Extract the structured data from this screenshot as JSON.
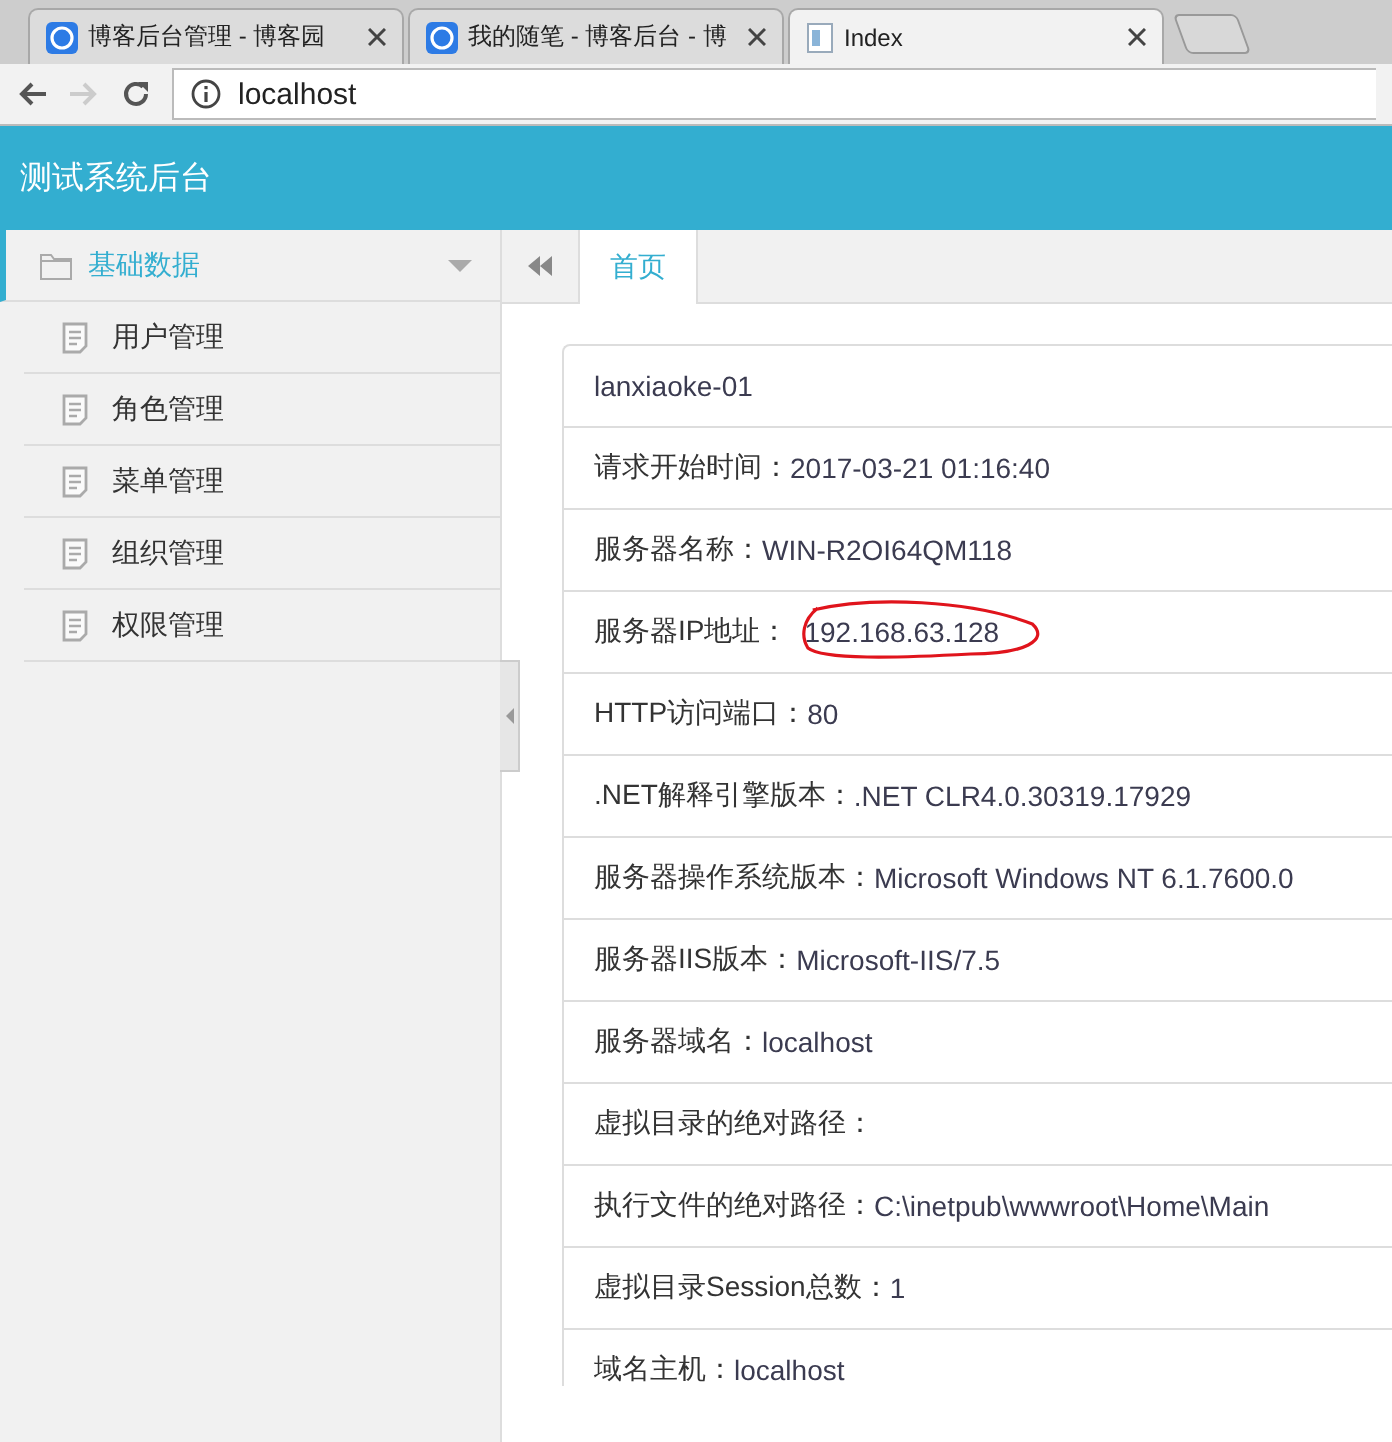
{
  "browser": {
    "tabs": [
      {
        "title": "博客后台管理 - 博客园",
        "selected": false,
        "kind": "site"
      },
      {
        "title": "我的随笔 - 博客后台 - 博",
        "selected": false,
        "kind": "site"
      },
      {
        "title": "Index",
        "selected": true,
        "kind": "page"
      }
    ],
    "address": "localhost"
  },
  "header": {
    "title": "测试系统后台"
  },
  "sidebar": {
    "group": {
      "label": "基础数据",
      "expanded": true
    },
    "items": [
      {
        "label": "用户管理"
      },
      {
        "label": "角色管理"
      },
      {
        "label": "菜单管理"
      },
      {
        "label": "组织管理"
      },
      {
        "label": "权限管理"
      }
    ]
  },
  "tabs": [
    {
      "label": "首页",
      "selected": true
    }
  ],
  "info_rows": [
    {
      "value": "lanxiaoke-01"
    },
    {
      "label": "请求开始时间：",
      "value": "2017-03-21 01:16:40"
    },
    {
      "label": "服务器名称：",
      "value": "WIN-R2OI64QM118"
    },
    {
      "label": "服务器IP地址：",
      "value": "192.168.63.128",
      "circled": true
    },
    {
      "label": "HTTP访问端口：",
      "value": "80"
    },
    {
      "label": ".NET解释引擎版本：",
      "value": ".NET CLR4.0.30319.17929"
    },
    {
      "label": "服务器操作系统版本：",
      "value": "Microsoft Windows NT 6.1.7600.0"
    },
    {
      "label": "服务器IIS版本：",
      "value": "Microsoft-IIS/7.5"
    },
    {
      "label": "服务器域名：",
      "value": "localhost"
    },
    {
      "label": "虚拟目录的绝对路径："
    },
    {
      "label": "执行文件的绝对路径：",
      "value": "C:\\inetpub\\wwwroot\\Home\\Main"
    },
    {
      "label": "虚拟目录Session总数：",
      "value": "1"
    },
    {
      "label": "域名主机：",
      "value": "localhost"
    }
  ]
}
